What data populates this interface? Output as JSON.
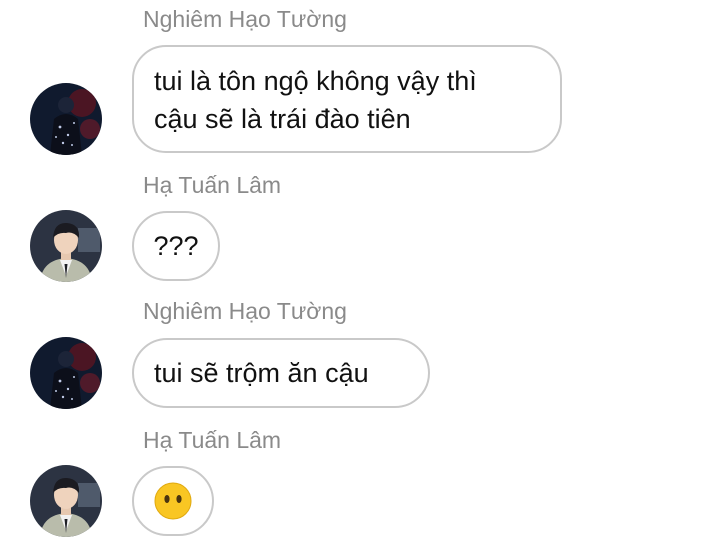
{
  "messages": [
    {
      "sender": "Nghiêm Hạo Tường",
      "lines": [
        "tui là tôn ngộ không vậy thì",
        "cậu sẽ là trái đào tiên"
      ]
    },
    {
      "sender": "Hạ Tuấn Lâm",
      "lines": [
        "???"
      ]
    },
    {
      "sender": "Nghiêm Hạo Tường",
      "lines": [
        "tui sẽ trộm ăn cậu"
      ]
    },
    {
      "sender": "Hạ Tuấn Lâm",
      "emoji": "face-without-mouth-icon"
    }
  ],
  "colors": {
    "sender_name": "#8a8a8a",
    "bubble_border": "#c9c9c9",
    "message_text": "#111111",
    "emoji_face": "#f9c623"
  }
}
